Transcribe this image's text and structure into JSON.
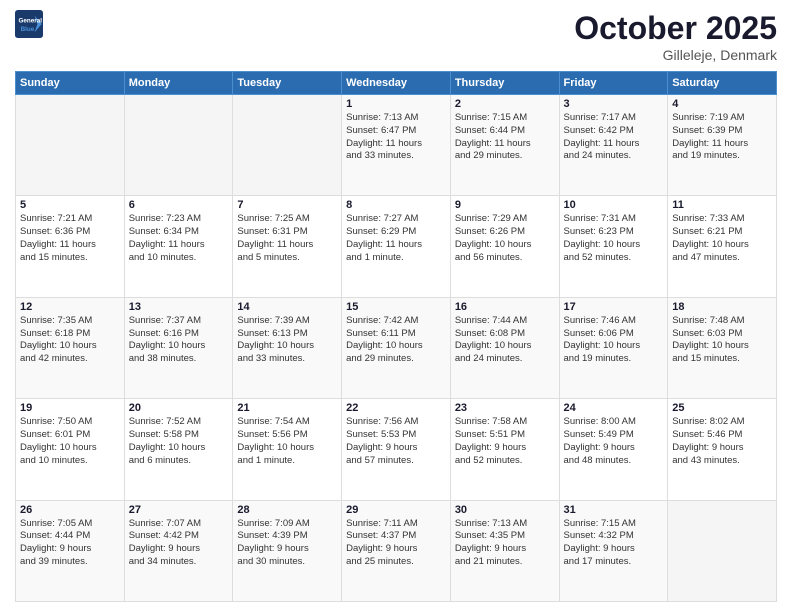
{
  "header": {
    "logo_line1": "General",
    "logo_line2": "Blue",
    "month_year": "October 2025",
    "location": "Gilleleje, Denmark"
  },
  "days_of_week": [
    "Sunday",
    "Monday",
    "Tuesday",
    "Wednesday",
    "Thursday",
    "Friday",
    "Saturday"
  ],
  "weeks": [
    [
      {
        "day": "",
        "info": ""
      },
      {
        "day": "",
        "info": ""
      },
      {
        "day": "",
        "info": ""
      },
      {
        "day": "1",
        "info": "Sunrise: 7:13 AM\nSunset: 6:47 PM\nDaylight: 11 hours\nand 33 minutes."
      },
      {
        "day": "2",
        "info": "Sunrise: 7:15 AM\nSunset: 6:44 PM\nDaylight: 11 hours\nand 29 minutes."
      },
      {
        "day": "3",
        "info": "Sunrise: 7:17 AM\nSunset: 6:42 PM\nDaylight: 11 hours\nand 24 minutes."
      },
      {
        "day": "4",
        "info": "Sunrise: 7:19 AM\nSunset: 6:39 PM\nDaylight: 11 hours\nand 19 minutes."
      }
    ],
    [
      {
        "day": "5",
        "info": "Sunrise: 7:21 AM\nSunset: 6:36 PM\nDaylight: 11 hours\nand 15 minutes."
      },
      {
        "day": "6",
        "info": "Sunrise: 7:23 AM\nSunset: 6:34 PM\nDaylight: 11 hours\nand 10 minutes."
      },
      {
        "day": "7",
        "info": "Sunrise: 7:25 AM\nSunset: 6:31 PM\nDaylight: 11 hours\nand 5 minutes."
      },
      {
        "day": "8",
        "info": "Sunrise: 7:27 AM\nSunset: 6:29 PM\nDaylight: 11 hours\nand 1 minute."
      },
      {
        "day": "9",
        "info": "Sunrise: 7:29 AM\nSunset: 6:26 PM\nDaylight: 10 hours\nand 56 minutes."
      },
      {
        "day": "10",
        "info": "Sunrise: 7:31 AM\nSunset: 6:23 PM\nDaylight: 10 hours\nand 52 minutes."
      },
      {
        "day": "11",
        "info": "Sunrise: 7:33 AM\nSunset: 6:21 PM\nDaylight: 10 hours\nand 47 minutes."
      }
    ],
    [
      {
        "day": "12",
        "info": "Sunrise: 7:35 AM\nSunset: 6:18 PM\nDaylight: 10 hours\nand 42 minutes."
      },
      {
        "day": "13",
        "info": "Sunrise: 7:37 AM\nSunset: 6:16 PM\nDaylight: 10 hours\nand 38 minutes."
      },
      {
        "day": "14",
        "info": "Sunrise: 7:39 AM\nSunset: 6:13 PM\nDaylight: 10 hours\nand 33 minutes."
      },
      {
        "day": "15",
        "info": "Sunrise: 7:42 AM\nSunset: 6:11 PM\nDaylight: 10 hours\nand 29 minutes."
      },
      {
        "day": "16",
        "info": "Sunrise: 7:44 AM\nSunset: 6:08 PM\nDaylight: 10 hours\nand 24 minutes."
      },
      {
        "day": "17",
        "info": "Sunrise: 7:46 AM\nSunset: 6:06 PM\nDaylight: 10 hours\nand 19 minutes."
      },
      {
        "day": "18",
        "info": "Sunrise: 7:48 AM\nSunset: 6:03 PM\nDaylight: 10 hours\nand 15 minutes."
      }
    ],
    [
      {
        "day": "19",
        "info": "Sunrise: 7:50 AM\nSunset: 6:01 PM\nDaylight: 10 hours\nand 10 minutes."
      },
      {
        "day": "20",
        "info": "Sunrise: 7:52 AM\nSunset: 5:58 PM\nDaylight: 10 hours\nand 6 minutes."
      },
      {
        "day": "21",
        "info": "Sunrise: 7:54 AM\nSunset: 5:56 PM\nDaylight: 10 hours\nand 1 minute."
      },
      {
        "day": "22",
        "info": "Sunrise: 7:56 AM\nSunset: 5:53 PM\nDaylight: 9 hours\nand 57 minutes."
      },
      {
        "day": "23",
        "info": "Sunrise: 7:58 AM\nSunset: 5:51 PM\nDaylight: 9 hours\nand 52 minutes."
      },
      {
        "day": "24",
        "info": "Sunrise: 8:00 AM\nSunset: 5:49 PM\nDaylight: 9 hours\nand 48 minutes."
      },
      {
        "day": "25",
        "info": "Sunrise: 8:02 AM\nSunset: 5:46 PM\nDaylight: 9 hours\nand 43 minutes."
      }
    ],
    [
      {
        "day": "26",
        "info": "Sunrise: 7:05 AM\nSunset: 4:44 PM\nDaylight: 9 hours\nand 39 minutes."
      },
      {
        "day": "27",
        "info": "Sunrise: 7:07 AM\nSunset: 4:42 PM\nDaylight: 9 hours\nand 34 minutes."
      },
      {
        "day": "28",
        "info": "Sunrise: 7:09 AM\nSunset: 4:39 PM\nDaylight: 9 hours\nand 30 minutes."
      },
      {
        "day": "29",
        "info": "Sunrise: 7:11 AM\nSunset: 4:37 PM\nDaylight: 9 hours\nand 25 minutes."
      },
      {
        "day": "30",
        "info": "Sunrise: 7:13 AM\nSunset: 4:35 PM\nDaylight: 9 hours\nand 21 minutes."
      },
      {
        "day": "31",
        "info": "Sunrise: 7:15 AM\nSunset: 4:32 PM\nDaylight: 9 hours\nand 17 minutes."
      },
      {
        "day": "",
        "info": ""
      }
    ]
  ]
}
